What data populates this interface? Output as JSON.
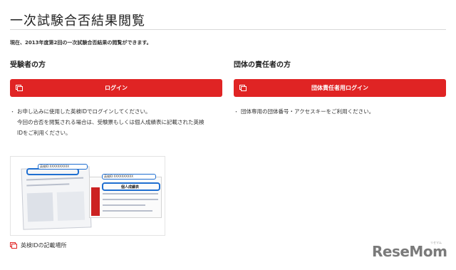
{
  "page": {
    "title": "一次試験合否結果閲覧",
    "intro": "現在、2013年度第2回の一次試験合否結果の閲覧ができます。"
  },
  "left": {
    "heading": "受験者の方",
    "button_label": "ログイン",
    "bullets": [
      "お申し込みに使用した英検IDでログインしてください。",
      "今回の合否を閲覧される場合は、受験票もしくは個人成績表に記載された英検",
      "IDをご利用ください。"
    ],
    "sample_callouts": [
      "英検ID:XXXXXXXXXX",
      "英検ID:XXXXXXXXXX"
    ],
    "sample_tag": "個人成績表",
    "caption": "英検IDの記載場所"
  },
  "right": {
    "heading": "団体の責任者の方",
    "button_label": "団体責任者用ログイン",
    "bullets": [
      "団体専用の団体番号・アクセスキーをご利用ください。"
    ]
  },
  "brand": {
    "watermark": "ReseMom",
    "watermark_sub": "リセマム"
  },
  "colors": {
    "accent": "#e02424",
    "highlight": "#1f6fd1"
  },
  "icons": {
    "button_icon": "window-link-icon",
    "caption_icon": "window-link-icon"
  }
}
